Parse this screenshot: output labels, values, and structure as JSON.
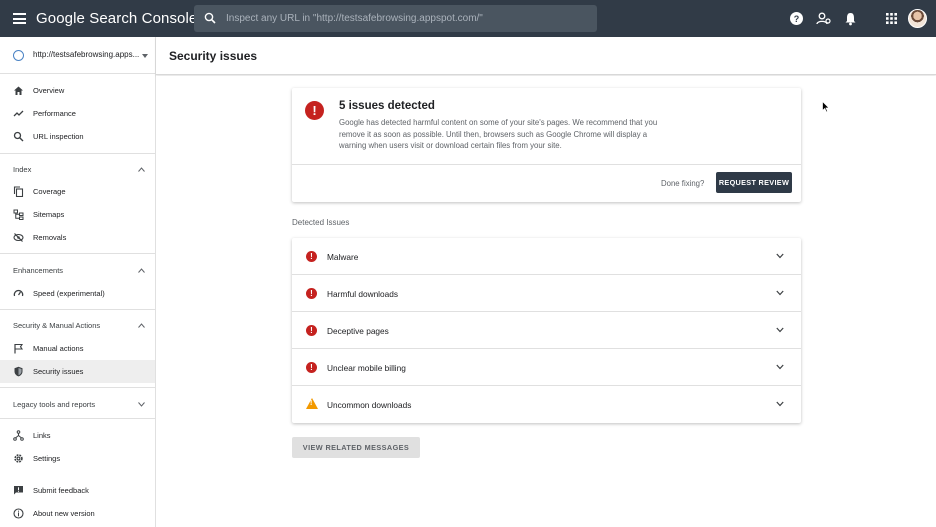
{
  "app": {
    "title": "Google Search Console"
  },
  "search": {
    "placeholder": "Inspect any URL in \"http://testsafebrowsing.appspot.com/\""
  },
  "property": {
    "label": "http://testsafebrowsing.apps..."
  },
  "sidebar": {
    "top_items": [
      {
        "label": "Overview",
        "icon": "home-icon"
      },
      {
        "label": "Performance",
        "icon": "trend-icon"
      },
      {
        "label": "URL inspection",
        "icon": "search-icon"
      }
    ],
    "sections": [
      {
        "title": "Index",
        "items": [
          {
            "label": "Coverage",
            "icon": "copy-icon"
          },
          {
            "label": "Sitemaps",
            "icon": "sitemap-icon"
          },
          {
            "label": "Removals",
            "icon": "eye-off-icon"
          }
        ]
      },
      {
        "title": "Enhancements",
        "items": [
          {
            "label": "Speed (experimental)",
            "icon": "gauge-icon"
          }
        ]
      },
      {
        "title": "Security & Manual Actions",
        "items": [
          {
            "label": "Manual actions",
            "icon": "flag-icon"
          },
          {
            "label": "Security issues",
            "icon": "shield-icon",
            "active": true
          }
        ]
      },
      {
        "title": "Legacy tools and reports",
        "items": []
      }
    ],
    "bottom_items": [
      {
        "label": "Links",
        "icon": "links-icon"
      },
      {
        "label": "Settings",
        "icon": "gear-icon"
      },
      {
        "label": "Submit feedback",
        "icon": "feedback-icon"
      },
      {
        "label": "About new version",
        "icon": "info-icon"
      }
    ]
  },
  "page": {
    "title": "Security issues"
  },
  "alert": {
    "title": "5 issues detected",
    "body": "Google has detected harmful content on some of your site's pages. We recommend that you remove it as soon as possible. Until then, browsers such as Google Chrome will display a warning when users visit or download certain files from your site.",
    "done_label": "Done fixing?",
    "request_button": "REQUEST REVIEW"
  },
  "detected": {
    "label": "Detected Issues",
    "issues": [
      {
        "label": "Malware",
        "severity": "error"
      },
      {
        "label": "Harmful downloads",
        "severity": "error"
      },
      {
        "label": "Deceptive pages",
        "severity": "error"
      },
      {
        "label": "Unclear mobile billing",
        "severity": "error"
      },
      {
        "label": "Uncommon downloads",
        "severity": "warning"
      }
    ]
  },
  "view_button": "VIEW RELATED MESSAGES",
  "colors": {
    "topbar": "#313b47",
    "error": "#c5221f",
    "warning": "#f29900",
    "button_dark": "#2f3a47"
  }
}
